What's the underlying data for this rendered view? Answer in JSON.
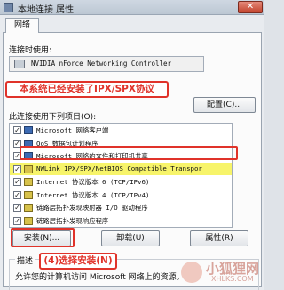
{
  "window": {
    "title": "本地连接 属性",
    "close": "✕"
  },
  "tab": {
    "label": "网络"
  },
  "connect_label": "连接时使用:",
  "adapter": {
    "name": "NVIDIA nForce Networking Controller",
    "icon": "network-card-icon"
  },
  "annotation_top": "本系统已经安装了IPX/SPX协议",
  "configure_button": "配置(C)...",
  "items_label": "此连接使用下列项目(O):",
  "items": [
    {
      "checked": "✓",
      "icon": "net",
      "text": "Microsoft 网络客户端"
    },
    {
      "checked": "✓",
      "icon": "net",
      "text": "QoS 数据包计划程序"
    },
    {
      "checked": "✓",
      "icon": "net",
      "text": "Microsoft 网络的文件和打印机共享"
    },
    {
      "checked": "✓",
      "icon": "proto",
      "text": "NWLink IPX/SPX/NetBIOS Compatible Transpor"
    },
    {
      "checked": "✓",
      "icon": "proto",
      "text": "Internet 协议版本 6 (TCP/IPv6)"
    },
    {
      "checked": "✓",
      "icon": "proto",
      "text": "Internet 协议版本 4 (TCP/IPv4)"
    },
    {
      "checked": "✓",
      "icon": "proto",
      "text": "链路层拓扑发现映射器 I/O 驱动程序"
    },
    {
      "checked": "✓",
      "icon": "proto",
      "text": "链路层拓扑发现响应程序"
    }
  ],
  "buttons": {
    "install": "安装(N)...",
    "uninstall": "卸载(U)",
    "properties": "属性(R)"
  },
  "description": {
    "label": "描述",
    "text": "允许您的计算机访问 Microsoft 网络上的资源。"
  },
  "annotation_bottom": "(4)选择安装(N)",
  "watermark": {
    "text": "小狐狸网",
    "sub": "XHLKS.COM"
  },
  "colors": {
    "annotation": "#e0332a",
    "selected_row": "#f7f46a"
  }
}
